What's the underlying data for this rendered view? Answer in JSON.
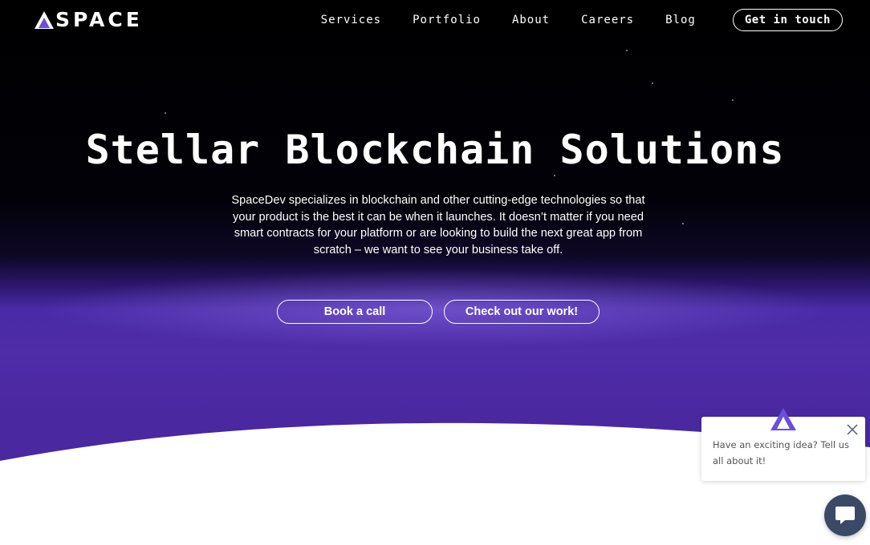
{
  "brand": {
    "name": "SPACE",
    "logo_icon": "triangle-logo-icon"
  },
  "nav": {
    "items": [
      {
        "label": "Services"
      },
      {
        "label": "Portfolio"
      },
      {
        "label": "About"
      },
      {
        "label": "Careers"
      },
      {
        "label": "Blog"
      }
    ],
    "cta_label": "Get in touch"
  },
  "hero": {
    "title": "Stellar Blockchain Solutions",
    "description": "SpaceDev specializes in blockchain and other cutting-edge technologies so that your product is the best it can be when it launches. It doesn’t matter if you need smart contracts for your platform or are looking to build the next great app from scratch – we want to see your business take off.",
    "primary_button": "Book a call",
    "secondary_button": "Check out our work!"
  },
  "chat": {
    "message": "Have an exciting idea? Tell us all about it!",
    "avatar_icon": "triangle-logo-icon",
    "close_icon": "close-icon",
    "launcher_icon": "chat-bubble-icon"
  },
  "colors": {
    "background_dark": "#000000",
    "hero_purple": "#4a28a0",
    "logo_purple": "#6b4fd8",
    "text_white": "#ffffff",
    "chat_launcher": "#3a4a66",
    "chat_text": "#555555"
  }
}
